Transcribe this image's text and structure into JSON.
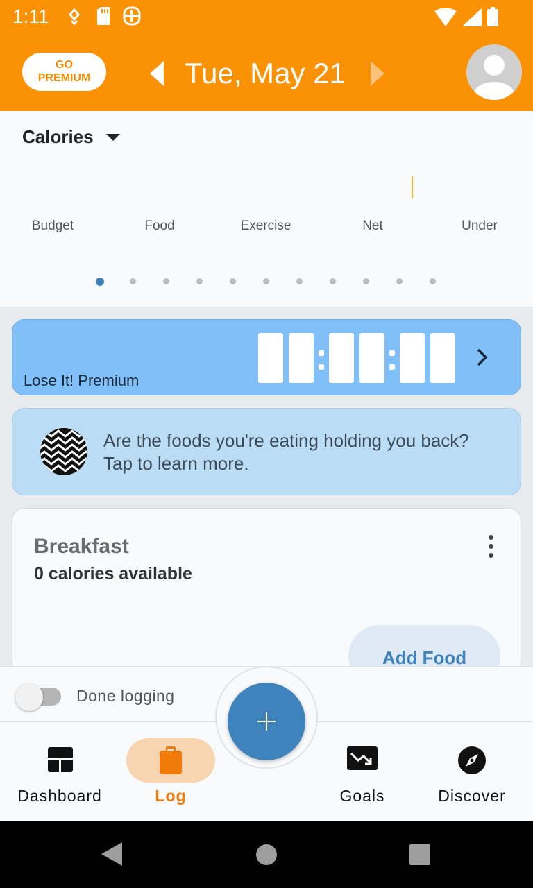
{
  "status_bar": {
    "time": "1:11"
  },
  "header": {
    "go_premium_label": "GO\nPREMIUM",
    "date": "Tue, May 21"
  },
  "calories": {
    "title": "Calories",
    "labels": [
      "Budget",
      "Food",
      "Exercise",
      "Net",
      "Under"
    ],
    "page_count": 11,
    "active_page": 1
  },
  "premium_card": {
    "label": "Lose It! Premium"
  },
  "learn_card": {
    "text": "Are the foods you're eating holding you back? Tap to learn more."
  },
  "meal": {
    "title": "Breakfast",
    "subtitle": "0 calories available",
    "add_food_label": "Add Food"
  },
  "done_logging": {
    "label": "Done logging",
    "enabled": false
  },
  "nav": {
    "dashboard": "Dashboard",
    "log": "Log",
    "goals": "Goals",
    "discover": "Discover",
    "active": "Log"
  },
  "colors": {
    "accent": "#fb9105",
    "primary_blue": "#3f83bc",
    "premium_card": "#80bff7",
    "learn_card": "#badcf5"
  }
}
